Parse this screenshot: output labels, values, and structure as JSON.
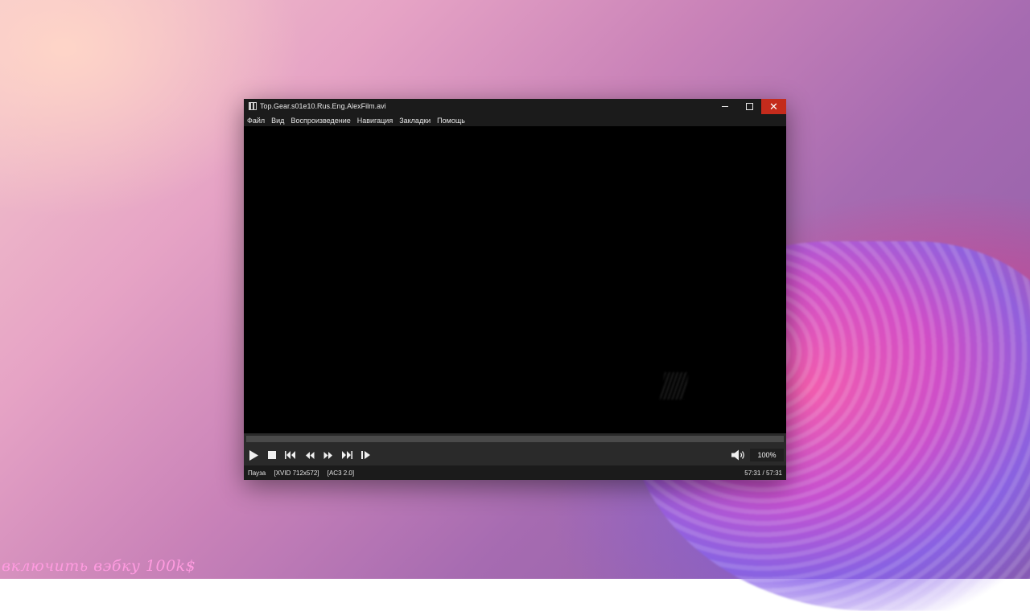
{
  "window": {
    "title": "Top.Gear.s01e10.Rus.Eng.AlexFilm.avi"
  },
  "menu": {
    "items": [
      "Файл",
      "Вид",
      "Воспроизведение",
      "Навигация",
      "Закладки",
      "Помощь"
    ]
  },
  "controls": {
    "volume_percent": "100%",
    "seek_position": 1.0
  },
  "status": {
    "state": "Пауза",
    "video_info": "[XVID 712x572]",
    "audio_info": "[AC3 2.0]",
    "time": "57:31 / 57:31"
  },
  "desktop": {
    "watermark": "включить вэбку 100k$"
  },
  "colors": {
    "close_button": "#c42b1c",
    "watermark": "#ff9be0"
  },
  "icons": {
    "app": "film-icon",
    "play": "play-icon",
    "stop": "stop-icon",
    "prev": "skip-previous-icon",
    "rewind": "rewind-icon",
    "forward": "fast-forward-icon",
    "next": "skip-next-icon",
    "frame_step": "frame-step-icon",
    "volume": "speaker-icon"
  }
}
